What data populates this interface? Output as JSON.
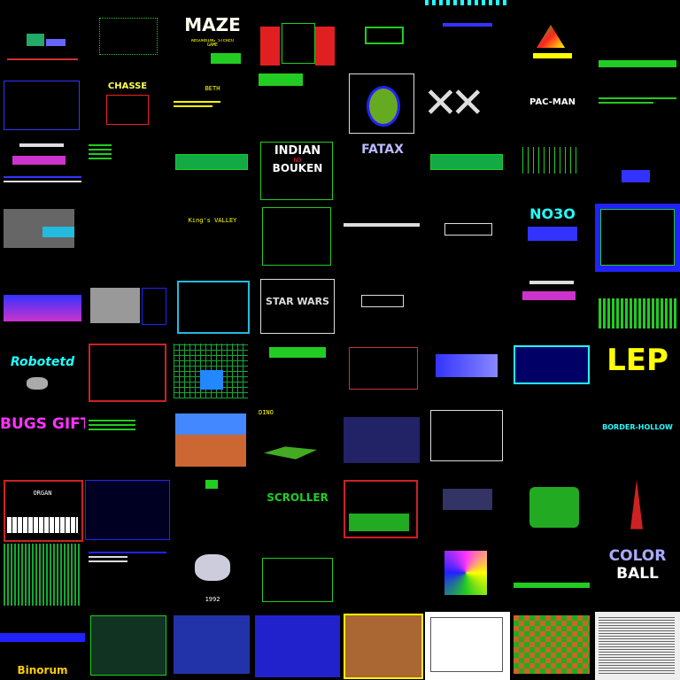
{
  "tiles": {
    "maze": "MAZE",
    "maze_sub": "ABSORBING STEREO GAME",
    "chasse": "CHASSE",
    "beth": "BETH",
    "pacman": "PAC-MAN",
    "indian": "INDIAN",
    "no": "NO",
    "bouken": "BOUKEN",
    "fatax": "FATAX",
    "kings_valley": "King's VALLEY",
    "nodo": "NO3O",
    "star_wars": "STAR WARS",
    "robotetd": "Robotetd",
    "lep": "LEP",
    "bugs_gift": "BUGS GIFT",
    "dino": "DINO",
    "border_hollow": "BORDER-HOLLOW",
    "color": "COLOR",
    "ball": "BALL",
    "organ": "ORGAN",
    "scroller": "SCROLLER",
    "year": "1992",
    "binorum": "Binorum"
  },
  "colors": {
    "background": "#000000",
    "green": "#22cc22",
    "blue": "#2a2aff",
    "red": "#e02020",
    "yellow": "#ffee00",
    "magenta": "#ff33ff",
    "cyan": "#22ddff",
    "white": "#ffffff"
  }
}
